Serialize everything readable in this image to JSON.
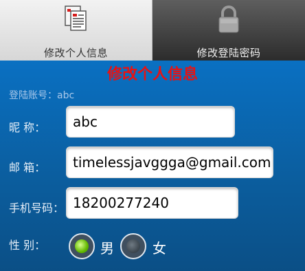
{
  "tabs": [
    {
      "label": "修改个人信息",
      "icon": "document-icon",
      "active": true
    },
    {
      "label": "修改登陆密码",
      "icon": "lock-icon",
      "active": false
    }
  ],
  "form": {
    "title": "修改个人信息",
    "account": {
      "label": "登陆账号：",
      "value": "abc"
    },
    "nickname": {
      "label": "昵    称：",
      "value": "abc"
    },
    "email": {
      "label": "邮    箱：",
      "value": "timelessjavggga@gmail.com"
    },
    "phone": {
      "label": "手机号码：",
      "value": "18200277240"
    },
    "gender": {
      "label": "性    别：",
      "options": [
        {
          "label": "男",
          "checked": true
        },
        {
          "label": "女",
          "checked": false
        }
      ]
    }
  },
  "colors": {
    "title": "#e81212",
    "background": "#0b5e9f",
    "radio_selected": "#63b900"
  }
}
